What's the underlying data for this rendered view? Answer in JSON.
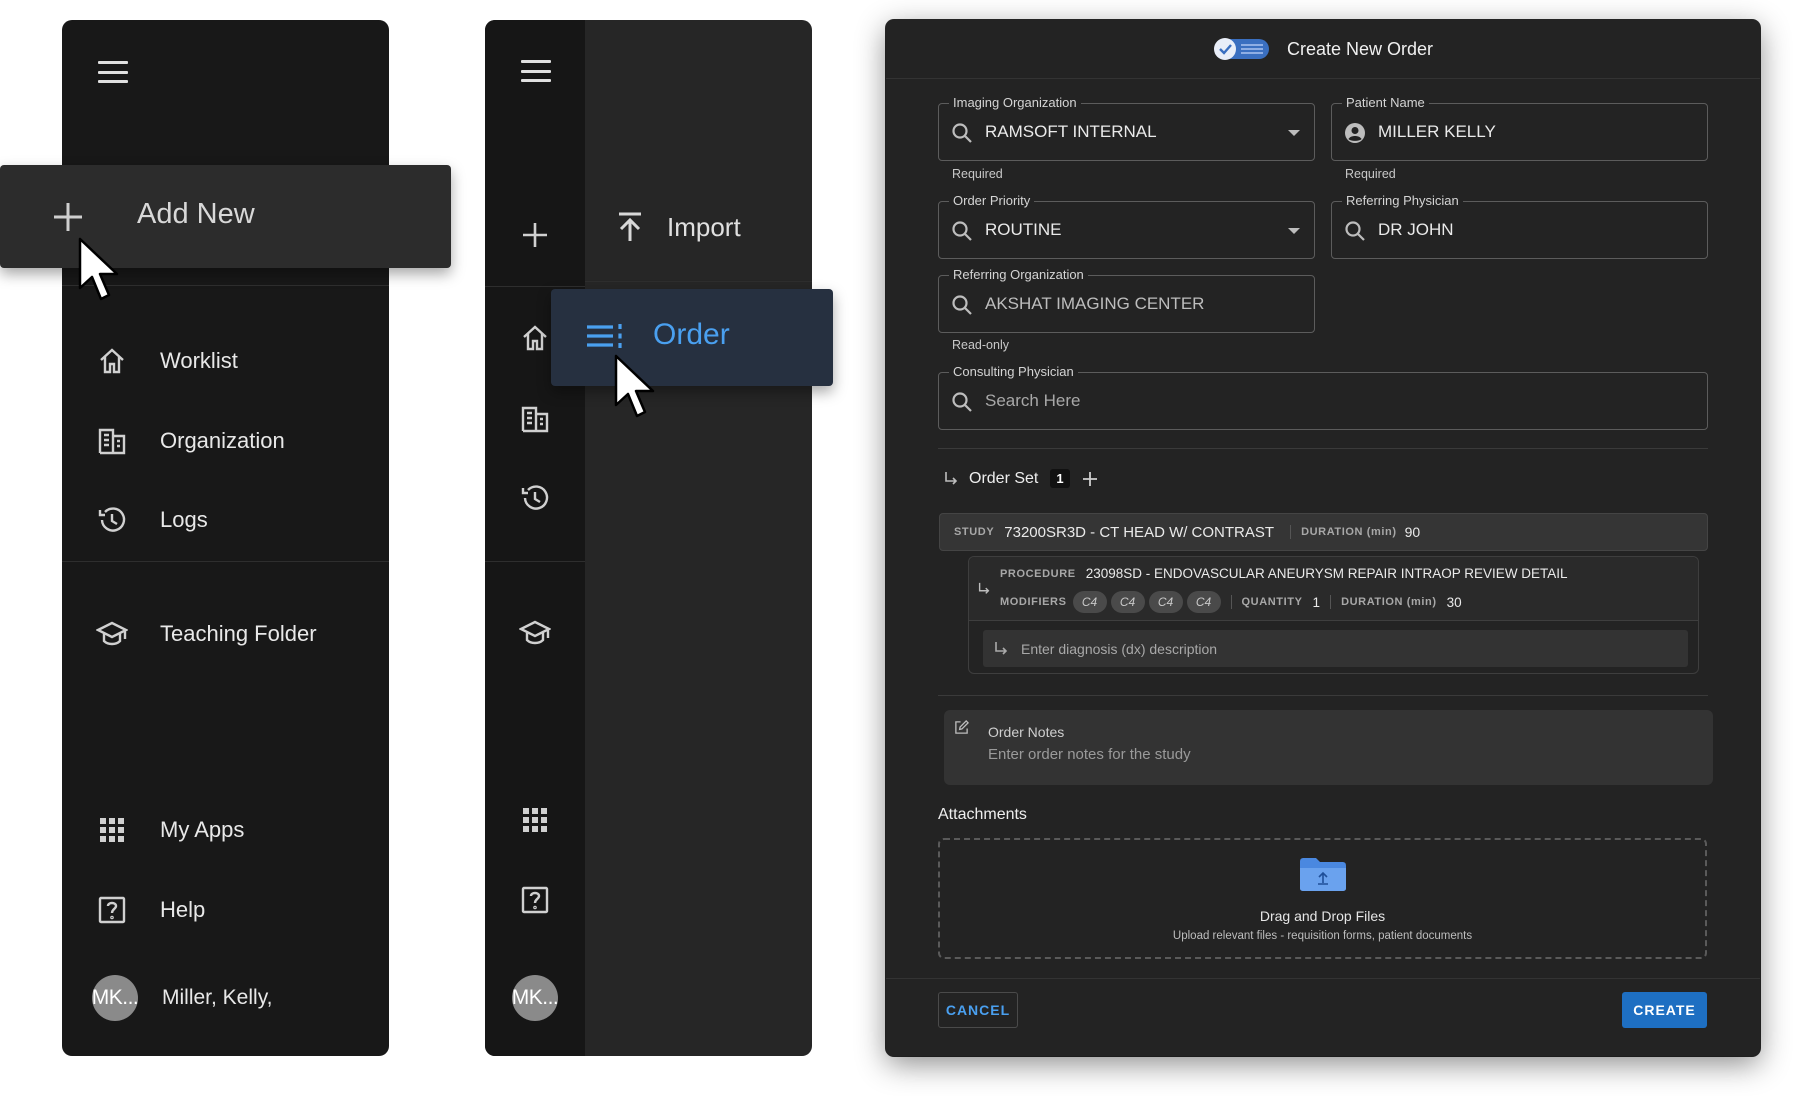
{
  "panel_left": {
    "add_new_label": "Add New",
    "nav": [
      {
        "label": "Worklist",
        "icon": "home-icon"
      },
      {
        "label": "Organization",
        "icon": "organization-icon"
      },
      {
        "label": "Logs",
        "icon": "history-icon"
      },
      {
        "label": "Teaching Folder",
        "icon": "graduation-cap-icon"
      },
      {
        "label": "My Apps",
        "icon": "apps-grid-icon"
      },
      {
        "label": "Help",
        "icon": "help-icon"
      }
    ],
    "user": {
      "initials": "MK...",
      "name": "Miller, Kelly,"
    }
  },
  "panel_middle": {
    "import_label": "Import",
    "order_label": "Order",
    "user_initials": "MK..."
  },
  "dialog": {
    "title": "Create New Order",
    "imaging_org": {
      "label": "Imaging Organization",
      "value": "RAMSOFT INTERNAL",
      "helper": "Required"
    },
    "patient_name": {
      "label": "Patient Name",
      "value": "MILLER KELLY",
      "helper": "Required"
    },
    "order_priority": {
      "label": "Order Priority",
      "value": "ROUTINE"
    },
    "referring_physician": {
      "label": "Referring Physician",
      "value": "DR JOHN"
    },
    "referring_org": {
      "label": "Referring Organization",
      "value": "AKSHAT IMAGING CENTER",
      "helper": "Read-only"
    },
    "consulting_physician": {
      "label": "Consulting Physician",
      "placeholder": "Search Here"
    },
    "order_set": {
      "label": "Order Set",
      "count": "1"
    },
    "study": {
      "tag": "STUDY",
      "name": "73200SR3D - CT HEAD W/ CONTRAST",
      "duration_label": "DURATION (min)",
      "duration": "90"
    },
    "procedure": {
      "tag": "PROCEDURE",
      "name": "23098SD - ENDOVASCULAR ANEURYSM REPAIR INTRAOP REVIEW DETAIL",
      "modifiers_label": "MODIFIERS",
      "modifiers": [
        "C4",
        "C4",
        "C4",
        "C4"
      ],
      "quantity_label": "QUANTITY",
      "quantity": "1",
      "duration_label": "DURATION (min)",
      "duration": "30"
    },
    "diagnosis_placeholder": "Enter diagnosis (dx) description",
    "order_notes": {
      "label": "Order Notes",
      "placeholder": "Enter order notes for the study"
    },
    "attachments": {
      "heading": "Attachments",
      "drop_title": "Drag and Drop Files",
      "drop_sub": "Upload relevant files - requisition forms, patient documents"
    },
    "cancel_label": "CANCEL",
    "create_label": "CREATE"
  },
  "colors": {
    "accent": "#4aa0f0",
    "primary_button": "#1e6fc2",
    "panel_bg": "#181818",
    "dialog_bg": "#232323"
  }
}
